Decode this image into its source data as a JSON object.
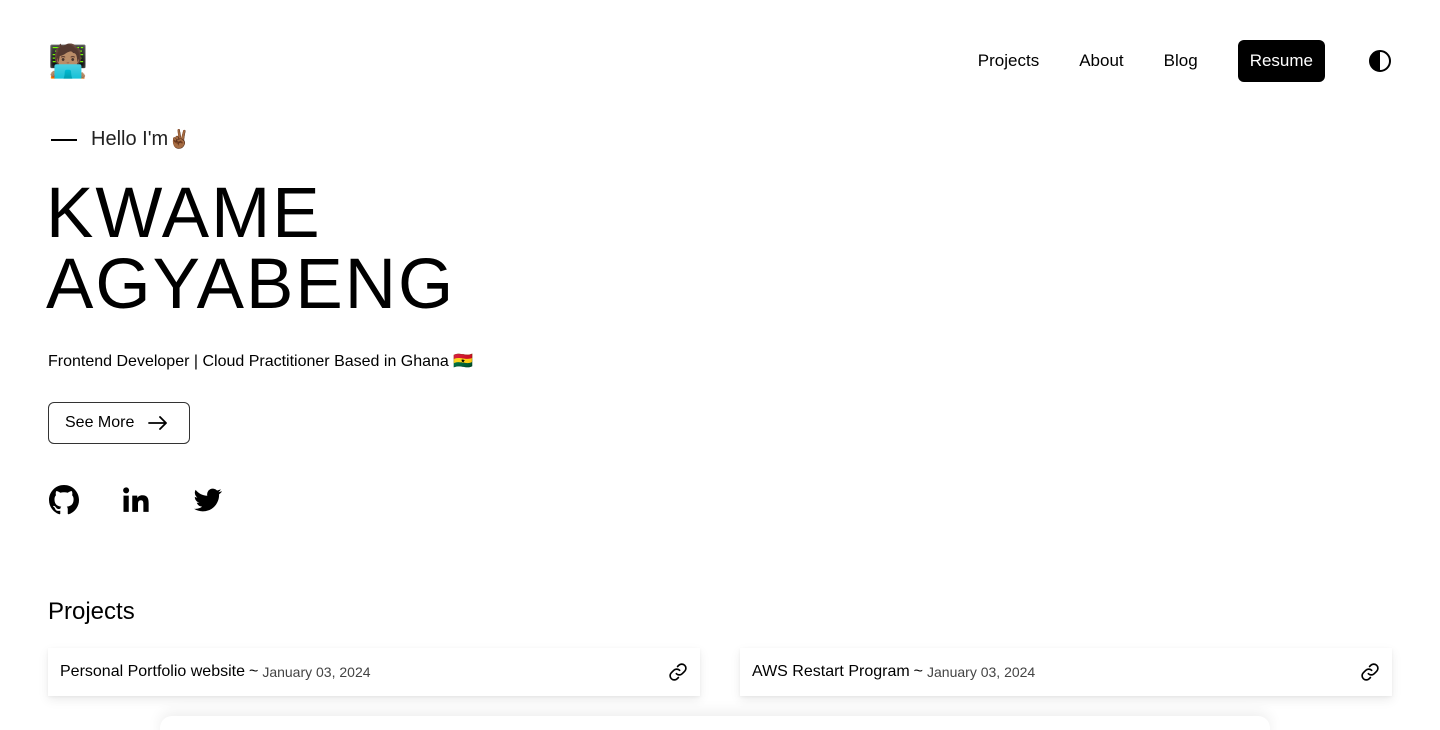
{
  "nav": {
    "logo_emoji": "🧑🏽‍💻",
    "links": [
      {
        "label": "Projects"
      },
      {
        "label": "About"
      },
      {
        "label": "Blog"
      }
    ],
    "resume_label": "Resume",
    "theme_icon": "contrast-icon"
  },
  "hero": {
    "greeting": "Hello I'm",
    "greeting_emoji": "✌🏾",
    "first_name": "KWAME",
    "last_name": "AGYABENG",
    "tagline": "Frontend Developer | Cloud Practitioner Based in Ghana 🇬🇭",
    "cta_label": "See More",
    "cta_icon": "arrow-right-icon",
    "socials": [
      {
        "name": "github-icon"
      },
      {
        "name": "linkedin-icon"
      },
      {
        "name": "twitter-icon"
      }
    ]
  },
  "projects": {
    "heading": "Projects",
    "items": [
      {
        "title": "Personal Portfolio website",
        "separator": "~",
        "date": "January 03, 2024",
        "icon": "link-icon"
      },
      {
        "title": "AWS Restart Program",
        "separator": "~",
        "date": "January 03, 2024",
        "icon": "link-icon"
      }
    ]
  },
  "colors": {
    "background": "#ffffff",
    "text": "#000000",
    "button_bg": "#000000",
    "button_text": "#ffffff"
  }
}
